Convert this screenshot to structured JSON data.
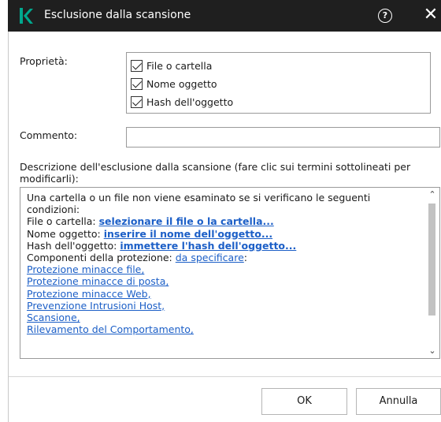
{
  "window": {
    "title": "Esclusione dalla scansione",
    "help_icon": "?",
    "close_icon": "✕"
  },
  "properties": {
    "label": "Proprietà:",
    "options": [
      {
        "label": "File o cartella",
        "checked": true
      },
      {
        "label": "Nome oggetto",
        "checked": true
      },
      {
        "label": "Hash dell'oggetto",
        "checked": true
      }
    ]
  },
  "comment": {
    "label": "Commento:",
    "value": ""
  },
  "description": {
    "label": "Descrizione dell'esclusione dalla scansione (fare clic sui termini sottolineati per modificarli):",
    "intro": "Una cartella o un file non viene esaminato se si verificano le seguenti condizioni:",
    "file_label": "File o cartella: ",
    "file_link": "selezionare il file o la cartella...",
    "name_label": "Nome oggetto: ",
    "name_link": "inserire il nome dell'oggetto...",
    "hash_label": "Hash dell'oggetto: ",
    "hash_link": "immettere l'hash dell'oggetto...",
    "components_label": "Componenti della protezione: ",
    "components_link": "da specificare",
    "components_colon": ":",
    "components": [
      "Protezione minacce file,",
      "Protezione minacce di posta,",
      "Protezione minacce Web,",
      "Prevenzione Intrusioni Host,",
      "Scansione,",
      "Rilevamento del Comportamento,"
    ]
  },
  "buttons": {
    "ok": "OK",
    "cancel": "Annulla"
  },
  "colors": {
    "titlebar": "#1f1f1f",
    "brand": "#00a88e",
    "link": "#1c5fc7"
  }
}
